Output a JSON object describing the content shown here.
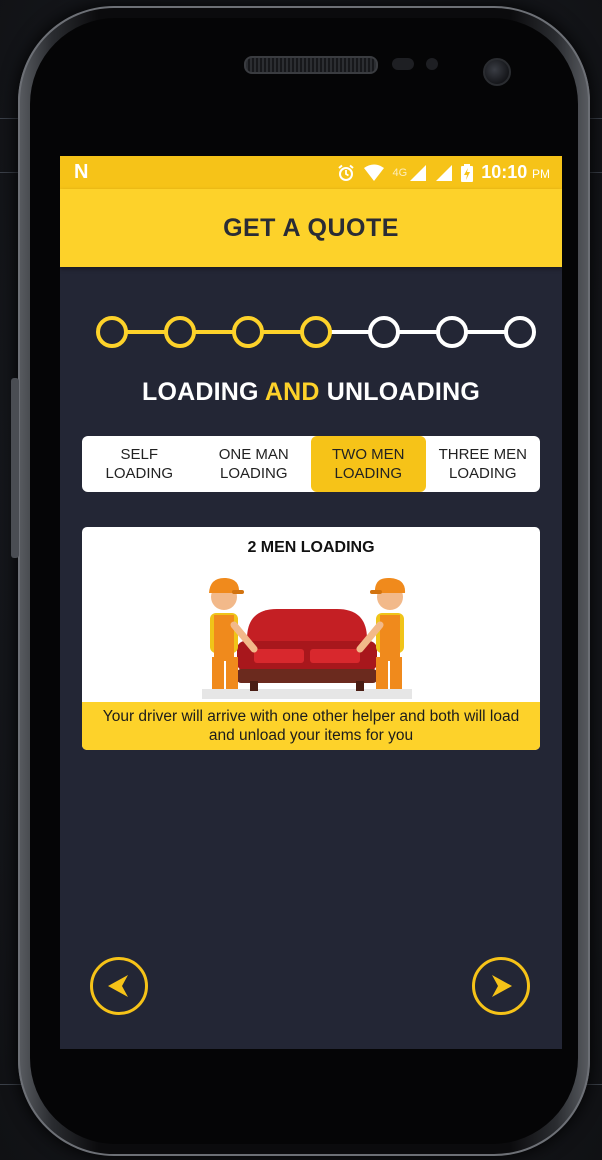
{
  "status_bar": {
    "time": "10:10",
    "period": "PM",
    "network": "4G",
    "notification_icon": "n-logo-icon",
    "icons": [
      "alarm-icon",
      "wifi-icon",
      "signal-icon",
      "signal-icon",
      "battery-icon"
    ]
  },
  "header": {
    "title": "GET A QUOTE"
  },
  "stepper": {
    "total_steps": 7,
    "completed_steps": 4,
    "active_color": "#fdd22a",
    "inactive_color": "#ffffff"
  },
  "section": {
    "title_part1": "LOADING ",
    "title_highlight": "AND",
    "title_part2": " UNLOADING"
  },
  "loading_options": [
    {
      "line1": "SELF",
      "line2": "LOADING",
      "selected": false
    },
    {
      "line1": "ONE MAN",
      "line2": "LOADING",
      "selected": false
    },
    {
      "line1": "TWO MEN",
      "line2": "LOADING",
      "selected": true
    },
    {
      "line1": "THREE MEN",
      "line2": "LOADING",
      "selected": false
    }
  ],
  "info_card": {
    "title": "2 MEN LOADING",
    "caption": "Your driver will arrive with one other helper and both will load and unload your items for you"
  },
  "navigation": {
    "back_icon": "chevron-left-icon",
    "next_icon": "chevron-right-icon"
  },
  "colors": {
    "accent": "#fdd22a",
    "status_bar": "#f6c318",
    "screen_bg": "#232635"
  }
}
